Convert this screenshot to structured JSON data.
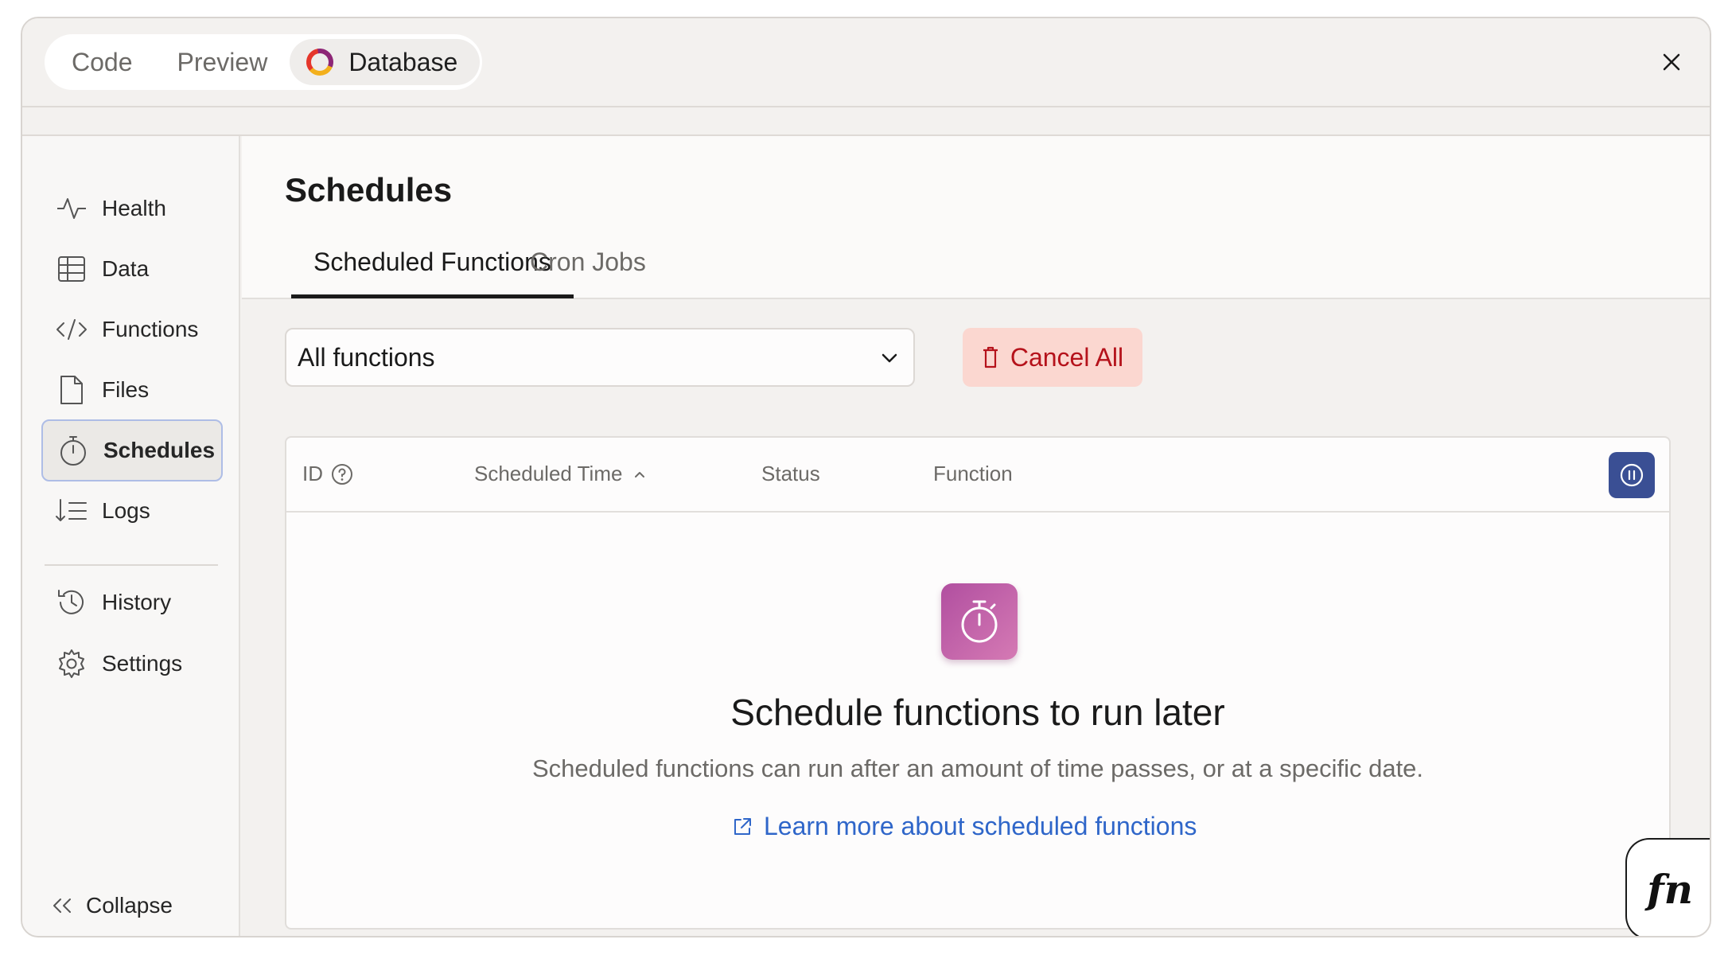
{
  "top_tabs": [
    {
      "label": "Code"
    },
    {
      "label": "Preview"
    },
    {
      "label": "Database"
    }
  ],
  "sidebar": {
    "items": [
      {
        "label": "Health"
      },
      {
        "label": "Data"
      },
      {
        "label": "Functions"
      },
      {
        "label": "Files"
      },
      {
        "label": "Schedules"
      },
      {
        "label": "Logs"
      }
    ],
    "secondary": [
      {
        "label": "History"
      },
      {
        "label": "Settings"
      }
    ],
    "collapse_label": "Collapse",
    "active": "Schedules"
  },
  "main": {
    "title": "Schedules",
    "tabs": [
      {
        "label": "Scheduled Functions"
      },
      {
        "label": "Cron Jobs"
      }
    ],
    "function_filter": {
      "selected": "All functions"
    },
    "cancel_all_label": "Cancel All",
    "table": {
      "columns": [
        "ID",
        "Scheduled Time",
        "Status",
        "Function"
      ]
    },
    "empty_state": {
      "title": "Schedule functions to run later",
      "description": "Scheduled functions can run after an amount of time passes, or at a specific date.",
      "link_label": "Learn more about scheduled functions"
    }
  },
  "fn_badge": "fn",
  "colors": {
    "accent_blue": "#3a4f94",
    "link_blue": "#2f66c9",
    "danger_bg": "#fbd7d0",
    "danger_text": "#b5121b",
    "empty_icon_gradient": [
      "#b14fa0",
      "#d57ab4"
    ]
  }
}
